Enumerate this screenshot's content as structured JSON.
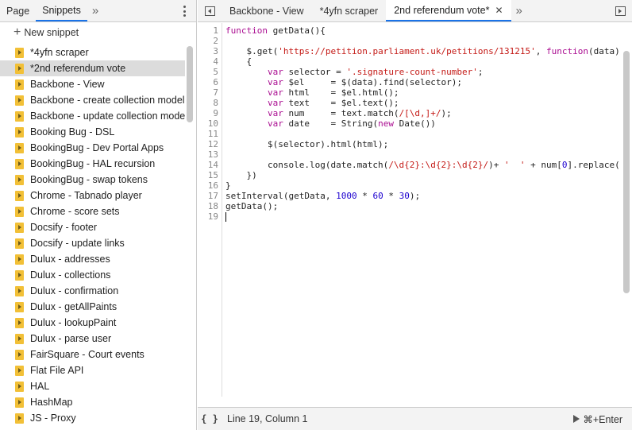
{
  "left_panel": {
    "tabs": [
      "Page",
      "Snippets"
    ],
    "more_tabs": "»",
    "new_snippet": "New snippet",
    "snippets": [
      "*4yfn scraper",
      "*2nd referendum vote",
      "Backbone - View",
      "Backbone - create collection model",
      "Backbone - update collection model",
      "Booking Bug - DSL",
      "BookingBug - Dev Portal Apps",
      "BookingBug - HAL recursion",
      "BookingBug - swap tokens",
      "Chrome - Tabnado player",
      "Chrome - score sets",
      "Docsify - footer",
      "Docsify - update links",
      "Dulux - addresses",
      "Dulux - collections",
      "Dulux - confirmation",
      "Dulux - getAllPaints",
      "Dulux - lookupPaint",
      "Dulux - parse user",
      "FairSquare - Court events",
      "Flat File API",
      "HAL",
      "HashMap",
      "JS - Proxy"
    ],
    "selected_index": 1
  },
  "editor": {
    "tabs": [
      "Backbone - View",
      "*4yfn scraper",
      "2nd referendum vote*"
    ],
    "active_tab_index": 2,
    "more_tabs": "»",
    "line_numbers": [
      "1",
      "2",
      "3",
      "4",
      "5",
      "6",
      "7",
      "8",
      "9",
      "10",
      "11",
      "12",
      "13",
      "14",
      "15",
      "16",
      "17",
      "18",
      "19"
    ]
  },
  "status": {
    "pretty_print": "{ }",
    "position": "Line 19, Column 1",
    "run_label": "⌘+Enter"
  },
  "colors": {
    "accent": "#1a73e8",
    "snippet_icon": "#f2c037",
    "keyword": "#aa0d91",
    "string": "#c41a16",
    "number": "#1c00cf"
  }
}
